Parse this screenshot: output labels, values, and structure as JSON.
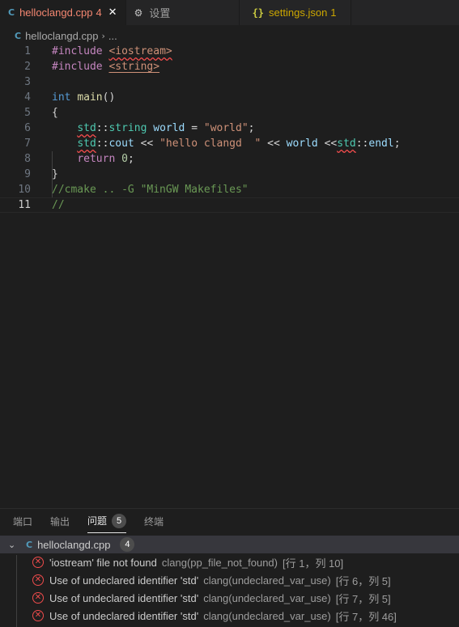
{
  "tabs": [
    {
      "icon": "C",
      "label": "helloclangd.cpp",
      "count": "4",
      "close": "✕"
    },
    {
      "icon": "⚙",
      "label": "设置"
    },
    {
      "icon": "{}",
      "label": "settings.json",
      "count": "1"
    }
  ],
  "breadcrumb": {
    "icon": "C",
    "file": "helloclangd.cpp",
    "sep": "›",
    "more": "..."
  },
  "editor": {
    "line_numbers": [
      "1",
      "2",
      "3",
      "4",
      "5",
      "6",
      "7",
      "8",
      "9",
      "10",
      "11"
    ]
  },
  "panel": {
    "tabs": [
      "端口",
      "输出",
      "问题",
      "终端"
    ],
    "problems_count": "5",
    "file": {
      "name": "helloclangd.cpp",
      "count": "4"
    },
    "problems": [
      {
        "message": "'iostream' file not found",
        "source": "clang(pp_file_not_found)",
        "location": "[行 1，列 10]"
      },
      {
        "message": "Use of undeclared identifier 'std'",
        "source": "clang(undeclared_var_use)",
        "location": "[行 6，列 5]"
      },
      {
        "message": "Use of undeclared identifier 'std'",
        "source": "clang(undeclared_var_use)",
        "location": "[行 7，列 5]"
      },
      {
        "message": "Use of undeclared identifier 'std'",
        "source": "clang(undeclared_var_use)",
        "location": "[行 7，列 46]"
      }
    ]
  },
  "colors": {
    "error": "#f14c4c",
    "active_tab_text": "#f48771",
    "warning": "#cca700"
  }
}
